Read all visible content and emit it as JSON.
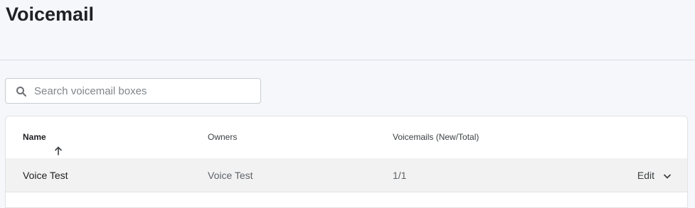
{
  "header": {
    "title": "Voicemail"
  },
  "search": {
    "placeholder": "Search voicemail boxes",
    "value": "",
    "icon": "search-icon"
  },
  "table": {
    "columns": [
      {
        "label": "Name",
        "sorted": "ascending",
        "sort_icon": "arrow-up-icon"
      },
      {
        "label": "Owners"
      },
      {
        "label": "Voicemails (New/Total)"
      }
    ],
    "rows": [
      {
        "name": "Voice Test",
        "owners": "Voice Test",
        "voicemails": "1/1",
        "action_label": "Edit",
        "action_icon": "chevron-down-icon"
      }
    ]
  },
  "colors": {
    "background": "#f5f7fa",
    "row_highlight": "#f2f2f2",
    "border": "#d9dde3"
  }
}
